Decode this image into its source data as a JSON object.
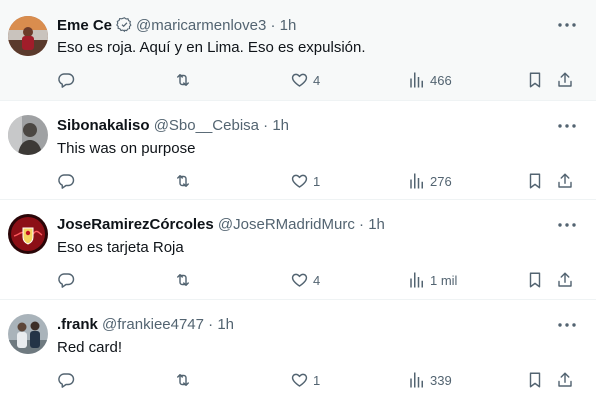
{
  "tweets": [
    {
      "name": "Eme Ce",
      "badge_icon": "verified-badge-icon",
      "handle": "@maricarmenlove3",
      "time": "1h",
      "text": "Eso es roja. Aquí y en Lima. Eso es expulsión.",
      "likes": "4",
      "views": "466",
      "avatar": "avatar-person-sunset"
    },
    {
      "name": "Sibonakaliso",
      "handle": "@Sbo__Cebisa",
      "time": "1h",
      "text": "This was on purpose",
      "likes": "1",
      "views": "276",
      "avatar": "avatar-person-gray"
    },
    {
      "name": "JoseRamirezCórcoles",
      "handle": "@JoseRMadridMurc",
      "time": "1h",
      "text": "Eso es tarjeta Roja",
      "likes": "4",
      "views": "1 mil",
      "avatar": "avatar-red-crest"
    },
    {
      "name": ".frank",
      "handle": "@frankiee4747",
      "time": "1h",
      "text": "Red card!",
      "likes": "1",
      "views": "339",
      "avatar": "avatar-two-people"
    }
  ],
  "separator": "·",
  "colors": {
    "text": "#0f1419",
    "secondary": "#536471",
    "highlight_background": "#f7f9f9",
    "divider": "#eff3f4"
  }
}
